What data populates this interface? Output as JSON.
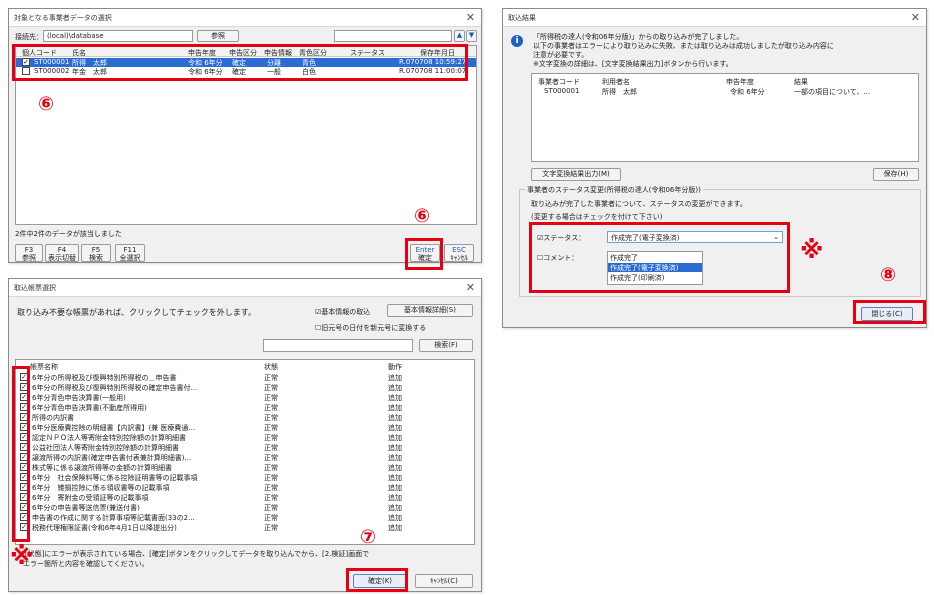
{
  "win1": {
    "title": "対象となる事業者データの選択",
    "conn_label": "接続先：",
    "conn_value": "(local)\\database",
    "browse": "参照",
    "cols": [
      "個人コード",
      "氏名",
      "申告年度",
      "申告区分",
      "申告情報",
      "青色区分",
      "ステータス",
      "保存年月日"
    ],
    "rows": [
      {
        "code": "ST000001",
        "name": "所得　太郎",
        "year": "令和 6年分",
        "type": "確定",
        "info": "分離",
        "blue": "青色",
        "saved": "R.070708 10:59:27",
        "checked": true
      },
      {
        "code": "ST000002",
        "name": "年金　太郎",
        "year": "令和 6年分",
        "type": "確定",
        "info": "一般",
        "blue": "白色",
        "saved": "R.070708 11:00:07",
        "checked": false
      }
    ],
    "status": "2件中2件のデータが該当しました",
    "fkeys": [
      {
        "key": "F3",
        "label": "参照"
      },
      {
        "key": "F4",
        "label": "表示切替"
      },
      {
        "key": "F5",
        "label": "検索"
      },
      {
        "key": "F11",
        "label": "全選択"
      }
    ],
    "enter_key": "Enter",
    "enter_label": "確定",
    "esc_key": "ESC",
    "esc_label": "ｷｬﾝｾﾙ",
    "badge_list": "⑥",
    "badge_enter": "⑥"
  },
  "win2": {
    "title": "取込結果",
    "msg1": "「所得税の達人(令和06年分版)」からの取り込みが完了しました。",
    "msg2": "以下の事業者はエラーにより取り込みに失敗、または取り込みは成功しましたが取り込み内容に",
    "msg3": "注意が必要です。",
    "msg4": "※文字変換の詳細は、[文字変換結果出力]ボタンから行います。",
    "cols": [
      "事業者コード",
      "利用者名",
      "申告年度",
      "結果"
    ],
    "row": {
      "code": "ST000001",
      "name": "所得　太郎",
      "year": "令和 6年分",
      "result": "一部の項目について、..."
    },
    "btn_convert": "文字変換結果出力(M)",
    "btn_save": "保存(H)",
    "group_label": "事業者のステータス変更(所得税の達人(令和06年分版))",
    "group_desc": "取り込みが完了した事業者について、ステータスの変更ができます。",
    "group_note": "(変更する場合はチェックを付けて下さい)",
    "status_label": "☑ステータス：",
    "status_value": "作成完了(電子変換済)",
    "comment_label": "☐コメント：",
    "options": [
      "作成完了",
      "作成完了(電子変換済)",
      "作成完了(印刷済)"
    ],
    "close": "閉じる(C)",
    "kome": "※",
    "badge_close": "⑧"
  },
  "win3": {
    "title": "取込帳票選択",
    "instruction": "取り込み不要な帳票があれば、クリックしてチェックを外します。",
    "basic_check": "☑基本情報の取込",
    "basic_detail": "基本情報詳細(S)",
    "era_check": "☐旧元号の日付を新元号に変換する",
    "search": "検索(F)",
    "cols": [
      "帳票名称",
      "状態",
      "動作"
    ],
    "rows": [
      {
        "name": "6年分の所得税及び復興特別所得税の＿申告書",
        "state": "正常",
        "action": "追加"
      },
      {
        "name": "6年分の所得税及び復興特別所得税の確定申告書付...",
        "state": "正常",
        "action": "追加"
      },
      {
        "name": "6年分青色申告決算書(一般用)",
        "state": "正常",
        "action": "追加"
      },
      {
        "name": "6年分青色申告決算書(不動産所得用)",
        "state": "正常",
        "action": "追加"
      },
      {
        "name": "所得の内訳書",
        "state": "正常",
        "action": "追加"
      },
      {
        "name": "6年分医療費控除の明細書【内訳書】(兼 医療費通...",
        "state": "正常",
        "action": "追加"
      },
      {
        "name": "認定ＮＰＯ法人等寄附金特別控除額の計算明細書",
        "state": "正常",
        "action": "追加"
      },
      {
        "name": "公益社団法人等寄附金特別控除額の計算明細書",
        "state": "正常",
        "action": "追加"
      },
      {
        "name": "譲渡所得の内訳書(確定申告書付表兼計算明細書)...",
        "state": "正常",
        "action": "追加"
      },
      {
        "name": "株式等に係る譲渡所得等の金額の計算明細書",
        "state": "正常",
        "action": "追加"
      },
      {
        "name": "6年分　社会保険料等に係る控除証明書等の記載事項",
        "state": "正常",
        "action": "追加"
      },
      {
        "name": "6年分　雑損控除に係る領収書等の記載事項",
        "state": "正常",
        "action": "追加"
      },
      {
        "name": "6年分　寄附金の受領証等の記載事項",
        "state": "正常",
        "action": "追加"
      },
      {
        "name": "6年分の申告書等送信票(兼送付書)",
        "state": "正常",
        "action": "追加"
      },
      {
        "name": "申告書の作成に関する計算事項等記載書面(33の2...",
        "state": "正常",
        "action": "追加"
      },
      {
        "name": "税務代理権限証書(令和6年4月1日以降提出分)",
        "state": "正常",
        "action": "追加"
      }
    ],
    "note1": "※[状態]にエラーが表示されている場合、[確定]ボタンをクリックしてデータを取り込んでから、[2.検証]画面で",
    "note2": "エラー箇所と内容を確認してください。",
    "ok": "確定(K)",
    "cancel": "ｷｬﾝｾﾙ(C)",
    "kome": "※",
    "badge_ok": "⑦"
  }
}
